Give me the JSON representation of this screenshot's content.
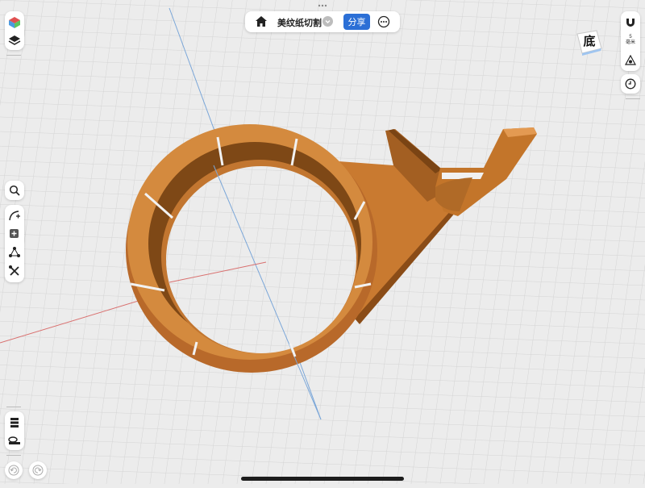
{
  "doc": {
    "title": "美纹纸切割",
    "share_label": "分享"
  },
  "view_cube": {
    "face_label": "底"
  },
  "units": {
    "scale_value": "5",
    "unit_label": "毫米"
  },
  "colors": {
    "model": "#c3752a",
    "model_dark": "#7a4414",
    "accent": "#2b6fd6",
    "background": "#ececec",
    "grid": "#d6d6d6",
    "axis_x": "#d9706f",
    "axis_y": "#7aa6d8"
  },
  "icons": {
    "top_left": [
      "appearance-cube-icon",
      "layers-icon"
    ],
    "left_tools": [
      "search-icon",
      "sketch-curve-icon",
      "add-primitive-icon",
      "transform-icon",
      "tools-icon"
    ],
    "left_bottom": [
      "stack-icon",
      "measure-icon"
    ],
    "history": [
      "undo-icon",
      "redo-icon"
    ],
    "right": [
      "snap-magnet-icon",
      "origin-icon",
      "history-clock-icon"
    ],
    "top_bar": [
      "home-icon",
      "dropdown-chevron-icon",
      "more-icon"
    ]
  }
}
